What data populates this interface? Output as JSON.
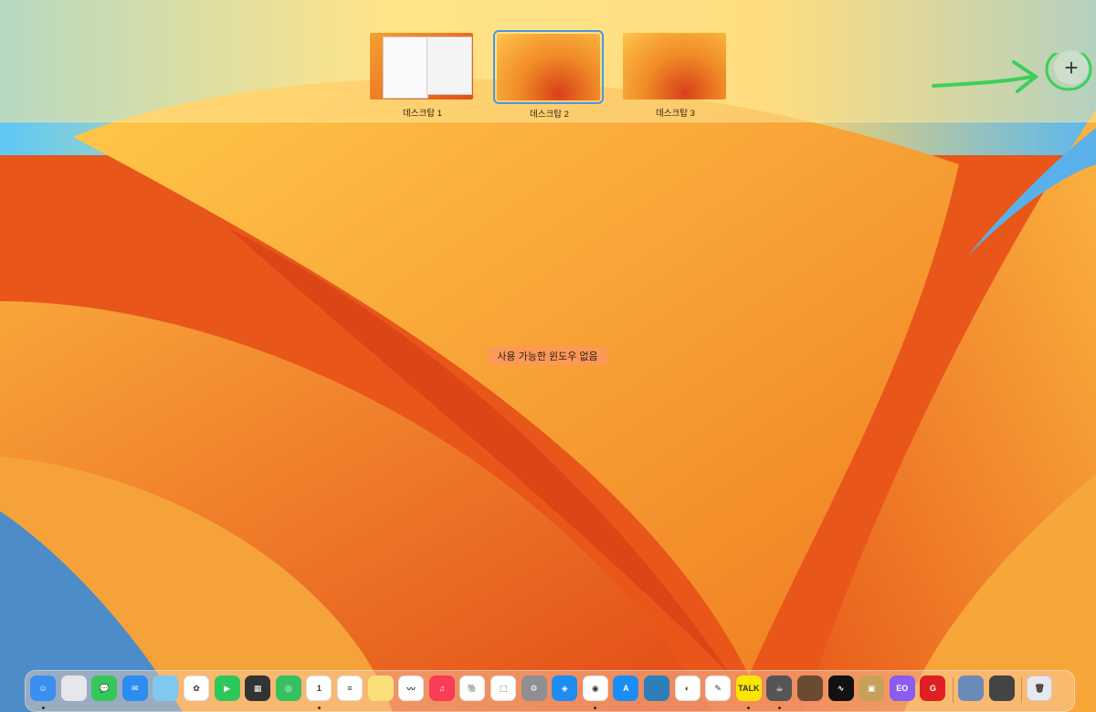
{
  "spaces_bar": {
    "spaces": [
      {
        "label": "데스크탑 1",
        "selected": false
      },
      {
        "label": "데스크탑 2",
        "selected": true
      },
      {
        "label": "데스크탑 3",
        "selected": false
      }
    ],
    "add_button_icon": "plus-icon",
    "add_button_glyph": "+"
  },
  "desktop": {
    "no_windows_text": "사용 가능한 윈도우 없음"
  },
  "dock": {
    "items": [
      {
        "name": "finder",
        "icon": "finder-icon",
        "color": "#3b8ff0",
        "glyph": "☺",
        "running": true
      },
      {
        "name": "launchpad",
        "icon": "launchpad-icon",
        "color": "#e6e6ec",
        "glyph": "",
        "running": false
      },
      {
        "name": "messages",
        "icon": "messages-icon",
        "color": "#34c759",
        "glyph": "💬",
        "running": false
      },
      {
        "name": "mail",
        "icon": "mail-icon",
        "color": "#2d8cf0",
        "glyph": "✉",
        "running": false
      },
      {
        "name": "maps",
        "icon": "maps-icon",
        "color": "#7fc8f0",
        "glyph": "",
        "running": false
      },
      {
        "name": "photos",
        "icon": "photos-icon",
        "color": "#ffffff",
        "glyph": "✿",
        "running": false
      },
      {
        "name": "facetime",
        "icon": "facetime-icon",
        "color": "#30c75a",
        "glyph": "▶",
        "running": false
      },
      {
        "name": "calculator",
        "icon": "calculator-icon",
        "color": "#333333",
        "glyph": "▦",
        "running": false
      },
      {
        "name": "find-my",
        "icon": "find-my-icon",
        "color": "#36c060",
        "glyph": "◎",
        "running": false
      },
      {
        "name": "calendar",
        "icon": "calendar-icon",
        "color": "#ffffff",
        "glyph": "1",
        "running": true
      },
      {
        "name": "reminders",
        "icon": "reminders-icon",
        "color": "#ffffff",
        "glyph": "≡",
        "running": false
      },
      {
        "name": "notes",
        "icon": "notes-icon",
        "color": "#fbe07a",
        "glyph": "",
        "running": false
      },
      {
        "name": "freeform",
        "icon": "freeform-icon",
        "color": "#ffffff",
        "glyph": "〰",
        "running": false
      },
      {
        "name": "music",
        "icon": "music-icon",
        "color": "#fa3c55",
        "glyph": "♫",
        "running": false
      },
      {
        "name": "evernote",
        "icon": "evernote-icon",
        "color": "#ffffff",
        "glyph": "🐘",
        "running": false
      },
      {
        "name": "screenshot",
        "icon": "screenshot-icon",
        "color": "#ffffff",
        "glyph": "⬚",
        "running": false
      },
      {
        "name": "system-settings",
        "icon": "system-settings-icon",
        "color": "#8e8e93",
        "glyph": "⚙",
        "running": false
      },
      {
        "name": "safari",
        "icon": "safari-icon",
        "color": "#1e8cf0",
        "glyph": "◈",
        "running": false
      },
      {
        "name": "chrome",
        "icon": "chrome-icon",
        "color": "#ffffff",
        "glyph": "◉",
        "running": true
      },
      {
        "name": "app-store",
        "icon": "app-store-icon",
        "color": "#1a8cf5",
        "glyph": "A",
        "running": false
      },
      {
        "name": "books",
        "icon": "books-icon",
        "color": "#2e7fb8",
        "glyph": "",
        "running": false
      },
      {
        "name": "magnifier",
        "icon": "magnifier-icon",
        "color": "#ffffff",
        "glyph": "◐",
        "running": false
      },
      {
        "name": "textedit",
        "icon": "textedit-icon",
        "color": "#ffffff",
        "glyph": "✎",
        "running": false
      },
      {
        "name": "kakaotalk",
        "icon": "kakaotalk-icon",
        "color": "#fee500",
        "glyph": "TALK",
        "running": true
      },
      {
        "name": "coffee-app",
        "icon": "coffee-icon",
        "color": "#555555",
        "glyph": "☕",
        "running": true
      },
      {
        "name": "script-editor",
        "icon": "script-editor-icon",
        "color": "#6b4a32",
        "glyph": "",
        "running": false
      },
      {
        "name": "activity-monitor",
        "icon": "activity-monitor-icon",
        "color": "#111111",
        "glyph": "∿",
        "running": false
      },
      {
        "name": "archive-utility",
        "icon": "archive-icon",
        "color": "#c9a05a",
        "glyph": "▣",
        "running": false
      },
      {
        "name": "eo-app",
        "icon": "eo-app-icon",
        "color": "#8a5cf0",
        "glyph": "EO",
        "running": false
      },
      {
        "name": "pro-app",
        "icon": "pro-app-icon",
        "color": "#e02020",
        "glyph": "G",
        "running": false
      },
      {
        "name": "downloads-folder",
        "icon": "folder-stack-icon",
        "color": "#6a8ab8",
        "glyph": "",
        "running": false
      },
      {
        "name": "applications-folder",
        "icon": "folder-stack-icon",
        "color": "#444444",
        "glyph": "",
        "running": false
      },
      {
        "name": "trash",
        "icon": "trash-icon",
        "color": "#e8e8ec",
        "glyph": "🗑",
        "running": false
      }
    ]
  }
}
